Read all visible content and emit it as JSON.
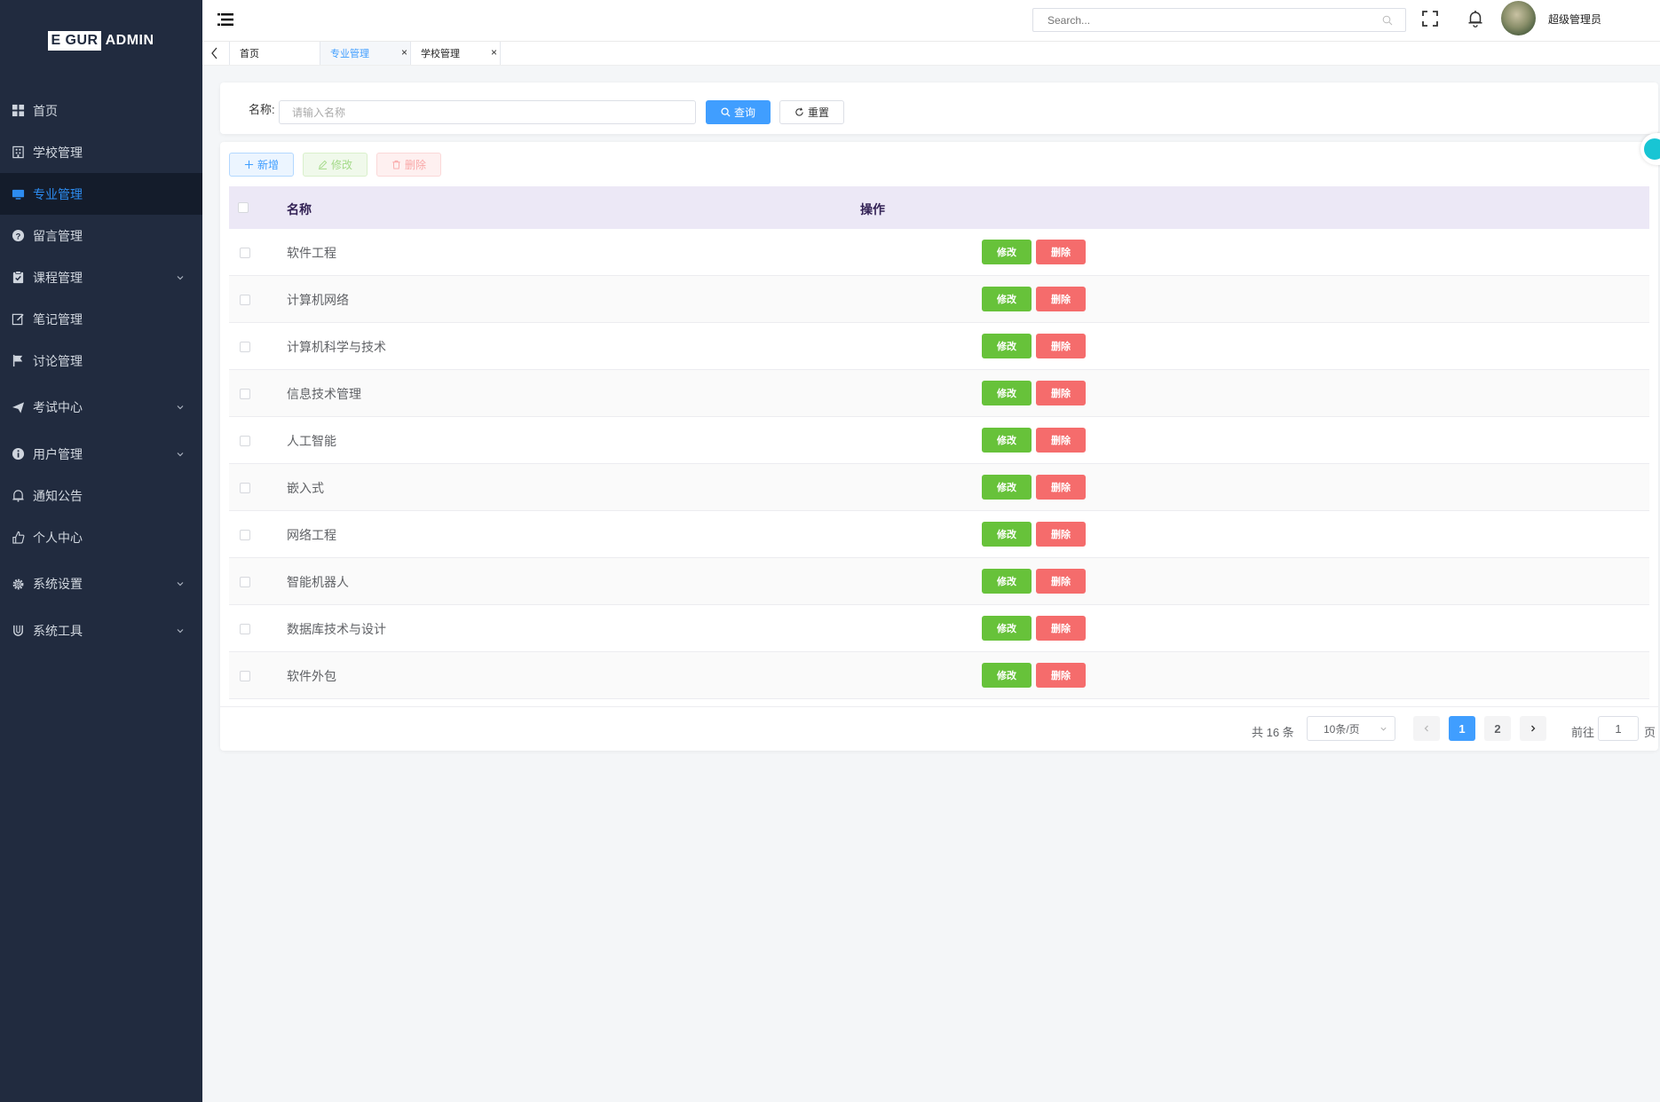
{
  "logo": {
    "part1": "E GUR",
    "part2": "ADMIN"
  },
  "sidebar": {
    "items": [
      {
        "label": "首页"
      },
      {
        "label": "学校管理"
      },
      {
        "label": "专业管理"
      },
      {
        "label": "留言管理"
      },
      {
        "label": "课程管理"
      },
      {
        "label": "笔记管理"
      },
      {
        "label": "讨论管理"
      },
      {
        "label": "考试中心"
      },
      {
        "label": "用户管理"
      },
      {
        "label": "通知公告"
      },
      {
        "label": "个人中心"
      },
      {
        "label": "系统设置"
      },
      {
        "label": "系统工具"
      }
    ]
  },
  "header": {
    "search_placeholder": "Search...",
    "username": "超级管理员"
  },
  "tabs": [
    {
      "label": "首页"
    },
    {
      "label": "专业管理",
      "close": "×"
    },
    {
      "label": "学校管理",
      "close": "×"
    }
  ],
  "query": {
    "name_label": "名称:",
    "name_placeholder": "请输入名称",
    "query_button": "查询",
    "reset_button": "重置"
  },
  "toolbar": {
    "add": "新增",
    "edit": "修改",
    "delete": "删除"
  },
  "table": {
    "columns": [
      "名称",
      "操作"
    ],
    "rows": [
      {
        "name": "软件工程"
      },
      {
        "name": "计算机网络"
      },
      {
        "name": "计算机科学与技术"
      },
      {
        "name": "信息技术管理"
      },
      {
        "name": "人工智能"
      },
      {
        "name": "嵌入式"
      },
      {
        "name": "网络工程"
      },
      {
        "name": "智能机器人"
      },
      {
        "name": "数据库技术与设计"
      },
      {
        "name": "软件外包"
      }
    ],
    "row_edit": "修改",
    "row_delete": "删除"
  },
  "pagination": {
    "total": "共 16 条",
    "page_size": "10条/页",
    "pages": [
      "1",
      "2"
    ],
    "goto_label": "前往",
    "goto_value": "1",
    "page_suffix": "页"
  },
  "colors": {
    "sidebar_bg": "#212b3f",
    "primary": "#409eff",
    "success": "#67c23a",
    "danger": "#f56c6c",
    "table_header_bg": "#ece8f6"
  }
}
